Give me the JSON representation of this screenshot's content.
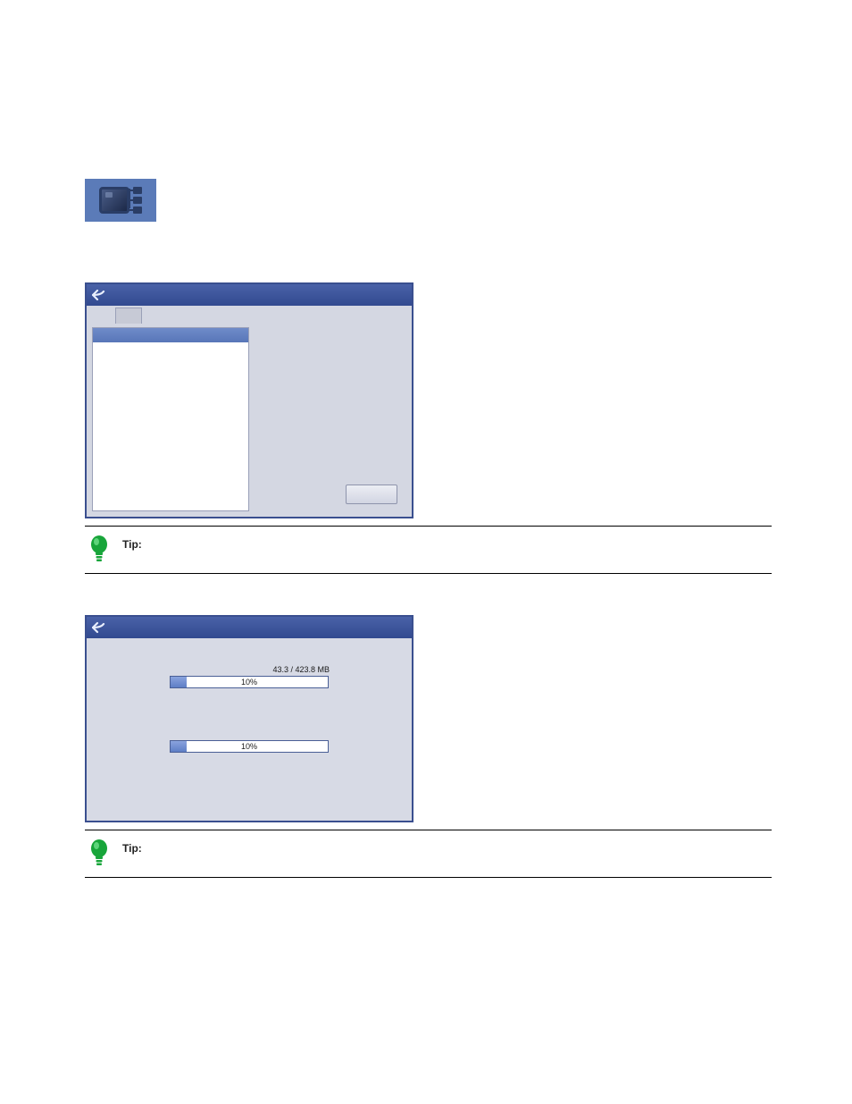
{
  "icons": {
    "device_tree": "device-tree-icon",
    "back": "back-arrow-icon",
    "bulb": "lightbulb-icon"
  },
  "file_picker": {
    "selected_item": "",
    "ok_label": ""
  },
  "tip1": {
    "prefix": "Tip:",
    "text": ""
  },
  "progress": {
    "size_text": "43.3 / 423.8 MB",
    "bar1_percent": 10,
    "bar1_label": "10%",
    "bar2_percent": 10,
    "bar2_label": "10%"
  },
  "tip2": {
    "prefix": "Tip:",
    "text": ""
  }
}
